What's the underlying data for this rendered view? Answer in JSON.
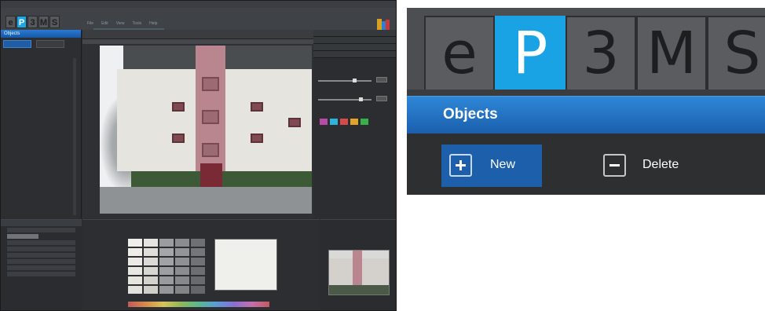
{
  "app": {
    "logo_letters": [
      "e",
      "P",
      "3",
      "M",
      "S"
    ],
    "active_letter_index": 1,
    "menu": [
      "File",
      "Edit",
      "View",
      "Tools",
      "Help"
    ],
    "left_panel_header": "Objects",
    "swatch_colors": [
      "#b84aa8",
      "#2fb3d6",
      "#d84a4a",
      "#e3a32a",
      "#38b04a"
    ]
  },
  "zoom": {
    "logo_letters": [
      "e",
      "P",
      "3",
      "M",
      "S"
    ],
    "active_letter_index": 1,
    "header": "Objects",
    "new_label": "New",
    "delete_label": "Delete"
  },
  "colors": {
    "accent": "#19a3e4",
    "header_blue": "#1b5fae",
    "dark_bg": "#2d2f31"
  }
}
